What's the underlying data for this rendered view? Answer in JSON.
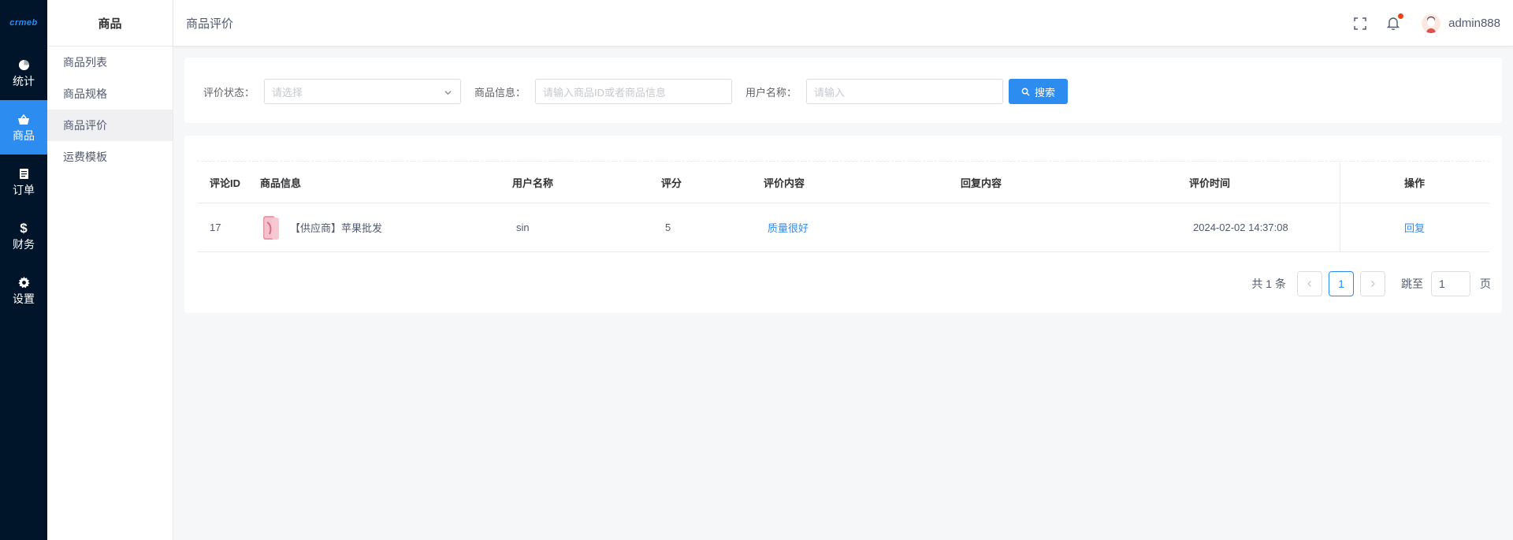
{
  "rail": {
    "logo": "crmeb",
    "items": [
      {
        "label": "统计",
        "icon": "pie-chart-icon"
      },
      {
        "label": "商品",
        "icon": "basket-icon"
      },
      {
        "label": "订单",
        "icon": "document-icon"
      },
      {
        "label": "财务",
        "icon": "dollar-icon"
      },
      {
        "label": "设置",
        "icon": "gear-icon"
      }
    ],
    "active_index": 1
  },
  "submenu": {
    "title": "商品",
    "items": [
      {
        "label": "商品列表"
      },
      {
        "label": "商品规格"
      },
      {
        "label": "商品评价"
      },
      {
        "label": "运费模板"
      }
    ],
    "active_index": 2
  },
  "header": {
    "breadcrumb": "商品评价",
    "username": "admin888"
  },
  "search": {
    "status_label": "评价状态：",
    "status_placeholder": "请选择",
    "product_label": "商品信息：",
    "product_placeholder": "请输入商品ID或者商品信息",
    "user_label": "用户名称：",
    "user_placeholder": "请输入",
    "search_button": "搜索"
  },
  "table": {
    "headers": {
      "id": "评论ID",
      "product": "商品信息",
      "user": "用户名称",
      "score": "评分",
      "content": "评价内容",
      "reply_content": "回复内容",
      "time": "评价时间",
      "action": "操作"
    },
    "rows": [
      {
        "id": "17",
        "product": "【供应商】苹果批发",
        "user": "sin",
        "score": "5",
        "content": "质量很好",
        "reply_content": "",
        "time": "2024-02-02 14:37:08",
        "action": "回复"
      }
    ]
  },
  "pagination": {
    "total_text": "共 1 条",
    "current_page": "1",
    "jump_label": "跳至",
    "jump_value": "1",
    "page_suffix": "页"
  },
  "colors": {
    "primary": "#2d8cf0",
    "rail_bg": "#001529",
    "notification_dot": "#ed4014"
  }
}
